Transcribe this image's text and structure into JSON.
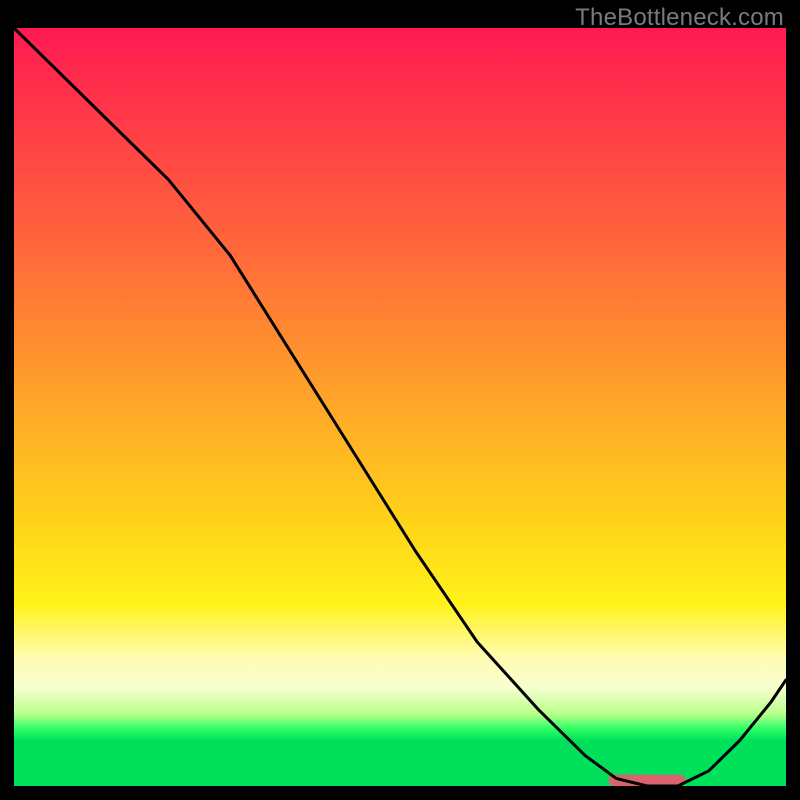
{
  "watermark": "TheBottleneck.com",
  "colors": {
    "gradient_top": "#ff1a52",
    "gradient_mid": "#ffd21a",
    "gradient_bottom": "#00e05a",
    "curve": "#000000",
    "marker": "#d9646e",
    "frame": "#000000"
  },
  "chart_data": {
    "type": "line",
    "title": "",
    "xlabel": "",
    "ylabel": "",
    "xlim": [
      0,
      100
    ],
    "ylim": [
      0,
      100
    ],
    "x": [
      0,
      5,
      12,
      20,
      28,
      36,
      44,
      52,
      60,
      68,
      74,
      78,
      82,
      86,
      90,
      94,
      98,
      100
    ],
    "values": [
      100,
      95,
      88,
      80,
      70,
      57,
      44,
      31,
      19,
      10,
      4,
      1,
      0,
      0,
      2,
      6,
      11,
      14
    ],
    "marker": {
      "x_start": 77,
      "x_end": 87,
      "y": 0,
      "height": 1.5
    },
    "note": "x and y are in percent of the plot area; y=0 is the bottom green strip, y=100 is the top edge. Values estimated from pixels."
  }
}
